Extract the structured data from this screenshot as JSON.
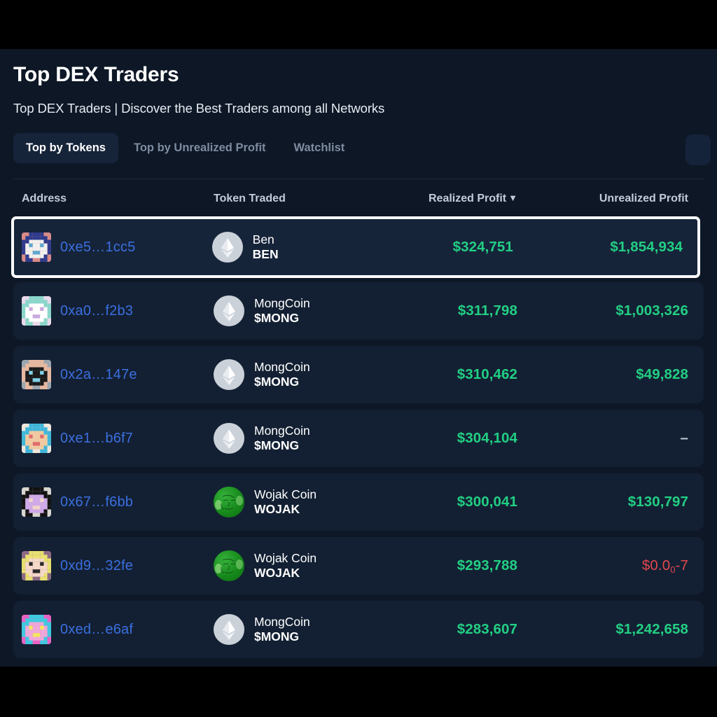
{
  "header": {
    "title": "Top DEX Traders",
    "subtitle": "Top DEX Traders | Discover the Best Traders among all Networks"
  },
  "tabs": [
    {
      "label": "Top by Tokens",
      "active": true
    },
    {
      "label": "Top by Unrealized Profit",
      "active": false
    },
    {
      "label": "Watchlist",
      "active": false
    }
  ],
  "table": {
    "columns": {
      "address": "Address",
      "token_traded": "Token Traded",
      "realized_profit": "Realized Profit",
      "unrealized_profit": "Unrealized Profit"
    },
    "sort": {
      "column": "Realized Profit",
      "direction": "desc",
      "caret": "▼"
    },
    "rows": [
      {
        "address": "0xe5…1cc5",
        "token_name": "Ben",
        "token_symbol": "BEN",
        "token_icon": "ethereum-token-icon",
        "realized_profit": "$324,751",
        "unrealized_profit": "$1,854,934",
        "unrealized_color": "green",
        "selected": true,
        "avatar_colors": [
          "#d98a86",
          "#2f3b8c",
          "#f2f0ee",
          "#5fa8d0"
        ]
      },
      {
        "address": "0xa0…f2b3",
        "token_name": "MongCoin",
        "token_symbol": "$MONG",
        "token_icon": "ethereum-token-icon",
        "realized_profit": "$311,798",
        "unrealized_profit": "$1,003,326",
        "unrealized_color": "green",
        "selected": false,
        "avatar_colors": [
          "#e9d9ea",
          "#8ad6ca",
          "#ffffff",
          "#c9a8dc"
        ]
      },
      {
        "address": "0x2a…147e",
        "token_name": "MongCoin",
        "token_symbol": "$MONG",
        "token_icon": "ethereum-token-icon",
        "realized_profit": "$310,462",
        "unrealized_profit": "$49,828",
        "unrealized_color": "green",
        "selected": false,
        "avatar_colors": [
          "#9ba6b0",
          "#e8b9a0",
          "#1b1b1b",
          "#7fd2e8"
        ]
      },
      {
        "address": "0xe1…b6f7",
        "token_name": "MongCoin",
        "token_symbol": "$MONG",
        "token_icon": "ethereum-token-icon",
        "realized_profit": "$304,104",
        "unrealized_profit": "–",
        "unrealized_color": "dash",
        "selected": false,
        "avatar_colors": [
          "#efe6dc",
          "#3fb6d8",
          "#f0c9a0",
          "#e06a6a"
        ]
      },
      {
        "address": "0x67…f6bb",
        "token_name": "Wojak Coin",
        "token_symbol": "WOJAK",
        "token_icon": "wojak-token-icon",
        "realized_profit": "$300,041",
        "unrealized_profit": "$130,797",
        "unrealized_color": "green",
        "selected": false,
        "avatar_colors": [
          "#d8d5cf",
          "#121212",
          "#cfa8e8",
          "#f0d4c8"
        ]
      },
      {
        "address": "0xd9…32fe",
        "token_name": "Wojak Coin",
        "token_symbol": "WOJAK",
        "token_icon": "wojak-token-icon",
        "realized_profit": "$293,788",
        "unrealized_profit_prefix": "$0.0",
        "unrealized_profit_sub": "0",
        "unrealized_profit_suffix": "-7",
        "unrealized_profit": "$0.0₀-7",
        "unrealized_color": "red",
        "selected": false,
        "avatar_colors": [
          "#8d6a86",
          "#e8e070",
          "#f6d8c8",
          "#2a2a2a"
        ]
      },
      {
        "address": "0xed…e6af",
        "token_name": "MongCoin",
        "token_symbol": "$MONG",
        "token_icon": "ethereum-token-icon",
        "realized_profit": "$283,607",
        "unrealized_profit": "$1,242,658",
        "unrealized_color": "green",
        "selected": false,
        "avatar_colors": [
          "#e862c4",
          "#3fc9e0",
          "#f0a8d8",
          "#f2e85a"
        ]
      }
    ]
  },
  "colors": {
    "background": "#0d1726",
    "row": "#132033",
    "row_selected": "#16243a",
    "profit_green": "#22cf83",
    "loss_red": "#e2484f",
    "address_link": "#3b6fe0",
    "selection_outline": "#ffffff"
  }
}
